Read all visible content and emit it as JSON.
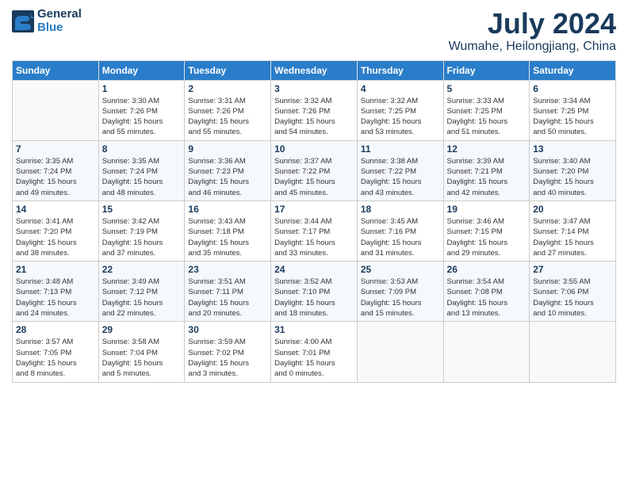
{
  "header": {
    "logo_line1": "General",
    "logo_line2": "Blue",
    "month_year": "July 2024",
    "location": "Wumahe, Heilongjiang, China"
  },
  "columns": [
    "Sunday",
    "Monday",
    "Tuesday",
    "Wednesday",
    "Thursday",
    "Friday",
    "Saturday"
  ],
  "weeks": [
    [
      {
        "day": "",
        "content": ""
      },
      {
        "day": "1",
        "content": "Sunrise: 3:30 AM\nSunset: 7:26 PM\nDaylight: 15 hours\nand 55 minutes."
      },
      {
        "day": "2",
        "content": "Sunrise: 3:31 AM\nSunset: 7:26 PM\nDaylight: 15 hours\nand 55 minutes."
      },
      {
        "day": "3",
        "content": "Sunrise: 3:32 AM\nSunset: 7:26 PM\nDaylight: 15 hours\nand 54 minutes."
      },
      {
        "day": "4",
        "content": "Sunrise: 3:32 AM\nSunset: 7:25 PM\nDaylight: 15 hours\nand 53 minutes."
      },
      {
        "day": "5",
        "content": "Sunrise: 3:33 AM\nSunset: 7:25 PM\nDaylight: 15 hours\nand 51 minutes."
      },
      {
        "day": "6",
        "content": "Sunrise: 3:34 AM\nSunset: 7:25 PM\nDaylight: 15 hours\nand 50 minutes."
      }
    ],
    [
      {
        "day": "7",
        "content": "Sunrise: 3:35 AM\nSunset: 7:24 PM\nDaylight: 15 hours\nand 49 minutes."
      },
      {
        "day": "8",
        "content": "Sunrise: 3:35 AM\nSunset: 7:24 PM\nDaylight: 15 hours\nand 48 minutes."
      },
      {
        "day": "9",
        "content": "Sunrise: 3:36 AM\nSunset: 7:23 PM\nDaylight: 15 hours\nand 46 minutes."
      },
      {
        "day": "10",
        "content": "Sunrise: 3:37 AM\nSunset: 7:22 PM\nDaylight: 15 hours\nand 45 minutes."
      },
      {
        "day": "11",
        "content": "Sunrise: 3:38 AM\nSunset: 7:22 PM\nDaylight: 15 hours\nand 43 minutes."
      },
      {
        "day": "12",
        "content": "Sunrise: 3:39 AM\nSunset: 7:21 PM\nDaylight: 15 hours\nand 42 minutes."
      },
      {
        "day": "13",
        "content": "Sunrise: 3:40 AM\nSunset: 7:20 PM\nDaylight: 15 hours\nand 40 minutes."
      }
    ],
    [
      {
        "day": "14",
        "content": "Sunrise: 3:41 AM\nSunset: 7:20 PM\nDaylight: 15 hours\nand 38 minutes."
      },
      {
        "day": "15",
        "content": "Sunrise: 3:42 AM\nSunset: 7:19 PM\nDaylight: 15 hours\nand 37 minutes."
      },
      {
        "day": "16",
        "content": "Sunrise: 3:43 AM\nSunset: 7:18 PM\nDaylight: 15 hours\nand 35 minutes."
      },
      {
        "day": "17",
        "content": "Sunrise: 3:44 AM\nSunset: 7:17 PM\nDaylight: 15 hours\nand 33 minutes."
      },
      {
        "day": "18",
        "content": "Sunrise: 3:45 AM\nSunset: 7:16 PM\nDaylight: 15 hours\nand 31 minutes."
      },
      {
        "day": "19",
        "content": "Sunrise: 3:46 AM\nSunset: 7:15 PM\nDaylight: 15 hours\nand 29 minutes."
      },
      {
        "day": "20",
        "content": "Sunrise: 3:47 AM\nSunset: 7:14 PM\nDaylight: 15 hours\nand 27 minutes."
      }
    ],
    [
      {
        "day": "21",
        "content": "Sunrise: 3:48 AM\nSunset: 7:13 PM\nDaylight: 15 hours\nand 24 minutes."
      },
      {
        "day": "22",
        "content": "Sunrise: 3:49 AM\nSunset: 7:12 PM\nDaylight: 15 hours\nand 22 minutes."
      },
      {
        "day": "23",
        "content": "Sunrise: 3:51 AM\nSunset: 7:11 PM\nDaylight: 15 hours\nand 20 minutes."
      },
      {
        "day": "24",
        "content": "Sunrise: 3:52 AM\nSunset: 7:10 PM\nDaylight: 15 hours\nand 18 minutes."
      },
      {
        "day": "25",
        "content": "Sunrise: 3:53 AM\nSunset: 7:09 PM\nDaylight: 15 hours\nand 15 minutes."
      },
      {
        "day": "26",
        "content": "Sunrise: 3:54 AM\nSunset: 7:08 PM\nDaylight: 15 hours\nand 13 minutes."
      },
      {
        "day": "27",
        "content": "Sunrise: 3:55 AM\nSunset: 7:06 PM\nDaylight: 15 hours\nand 10 minutes."
      }
    ],
    [
      {
        "day": "28",
        "content": "Sunrise: 3:57 AM\nSunset: 7:05 PM\nDaylight: 15 hours\nand 8 minutes."
      },
      {
        "day": "29",
        "content": "Sunrise: 3:58 AM\nSunset: 7:04 PM\nDaylight: 15 hours\nand 5 minutes."
      },
      {
        "day": "30",
        "content": "Sunrise: 3:59 AM\nSunset: 7:02 PM\nDaylight: 15 hours\nand 3 minutes."
      },
      {
        "day": "31",
        "content": "Sunrise: 4:00 AM\nSunset: 7:01 PM\nDaylight: 15 hours\nand 0 minutes."
      },
      {
        "day": "",
        "content": ""
      },
      {
        "day": "",
        "content": ""
      },
      {
        "day": "",
        "content": ""
      }
    ]
  ]
}
